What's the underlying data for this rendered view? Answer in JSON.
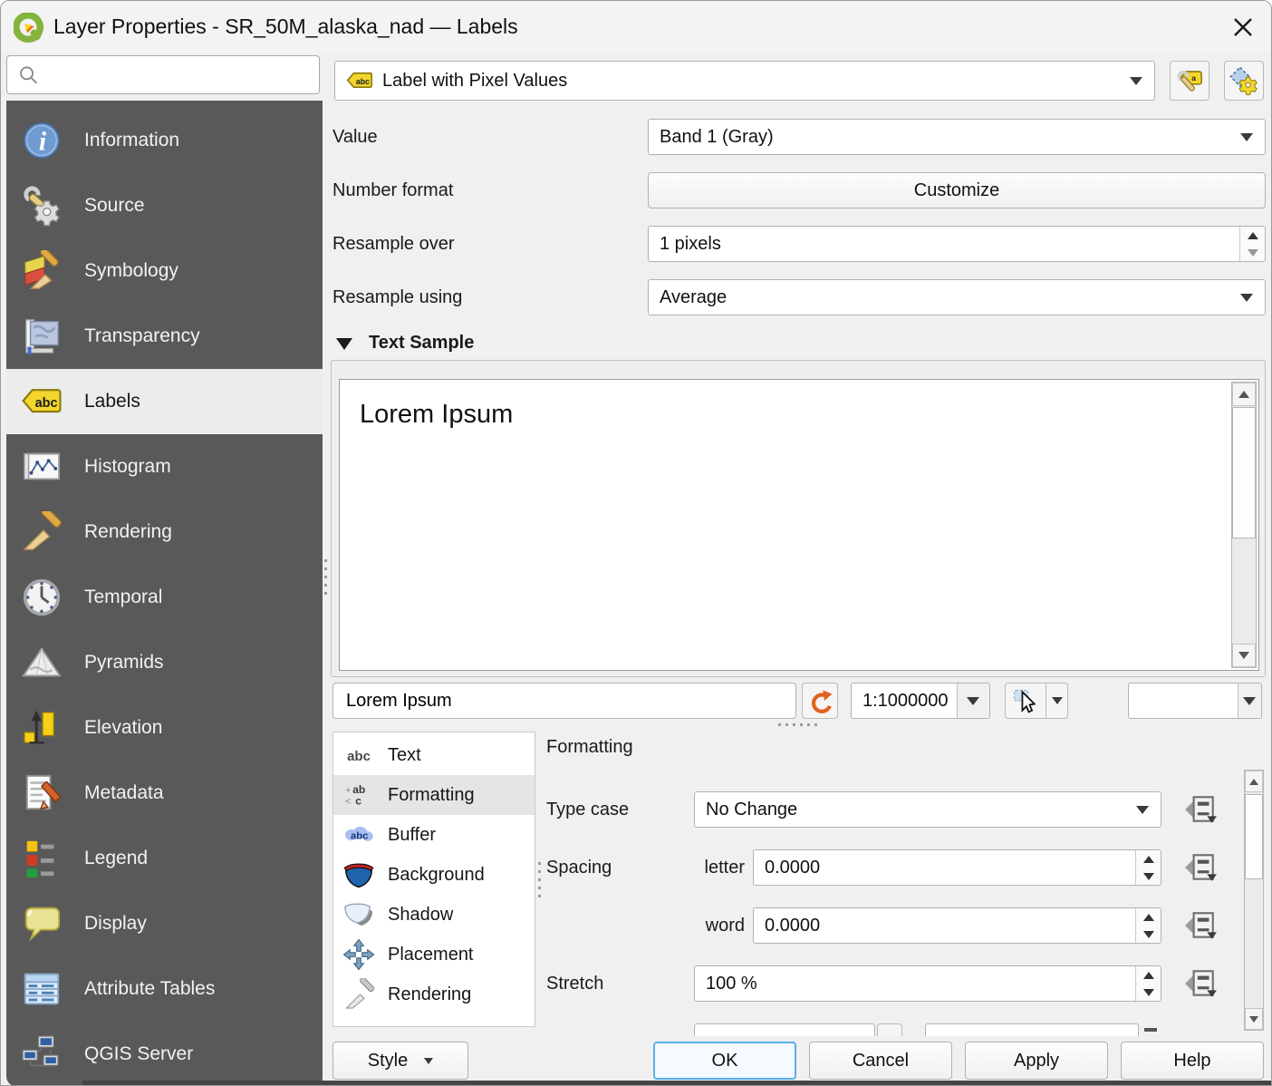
{
  "window": {
    "title": "Layer Properties - SR_50M_alaska_nad — Labels"
  },
  "sidebar": {
    "search_value": "",
    "items": [
      {
        "label": "Information"
      },
      {
        "label": "Source"
      },
      {
        "label": "Symbology"
      },
      {
        "label": "Transparency"
      },
      {
        "label": "Labels"
      },
      {
        "label": "Histogram"
      },
      {
        "label": "Rendering"
      },
      {
        "label": "Temporal"
      },
      {
        "label": "Pyramids"
      },
      {
        "label": "Elevation"
      },
      {
        "label": "Metadata"
      },
      {
        "label": "Legend"
      },
      {
        "label": "Display"
      },
      {
        "label": "Attribute Tables"
      },
      {
        "label": "QGIS Server"
      }
    ]
  },
  "header": {
    "label_mode": "Label with Pixel Values"
  },
  "form": {
    "value_label": "Value",
    "value_value": "Band 1 (Gray)",
    "number_format_label": "Number format",
    "customize_button": "Customize",
    "resample_over_label": "Resample over",
    "resample_over_value": "1 pixels",
    "resample_using_label": "Resample using",
    "resample_using_value": "Average"
  },
  "sample": {
    "section_title": "Text Sample",
    "preview_text": "Lorem Ipsum",
    "input_value": "Lorem Ipsum",
    "scale_value": "1:1000000",
    "font_combo_value": ""
  },
  "tabs": {
    "items": [
      {
        "label": "Text"
      },
      {
        "label": "Formatting"
      },
      {
        "label": "Buffer"
      },
      {
        "label": "Background"
      },
      {
        "label": "Shadow"
      },
      {
        "label": "Placement"
      },
      {
        "label": "Rendering"
      }
    ]
  },
  "formatting": {
    "panel_title": "Formatting",
    "type_case_label": "Type case",
    "type_case_value": "No Change",
    "spacing_label": "Spacing",
    "letter_label": "letter",
    "letter_value": "0.0000",
    "word_label": "word",
    "word_value": "0.0000",
    "stretch_label": "Stretch",
    "stretch_value": "100 %"
  },
  "footer": {
    "style_button": "Style",
    "ok_button": "OK",
    "cancel_button": "Cancel",
    "apply_button": "Apply",
    "help_button": "Help"
  },
  "colors": {
    "sidebar_bg": "#595959",
    "selected_item_bg": "#ececeb",
    "ok_accent": "#5aaee8",
    "undo_orange": "#e2611d",
    "tag_yellow": "#f3d52b"
  }
}
